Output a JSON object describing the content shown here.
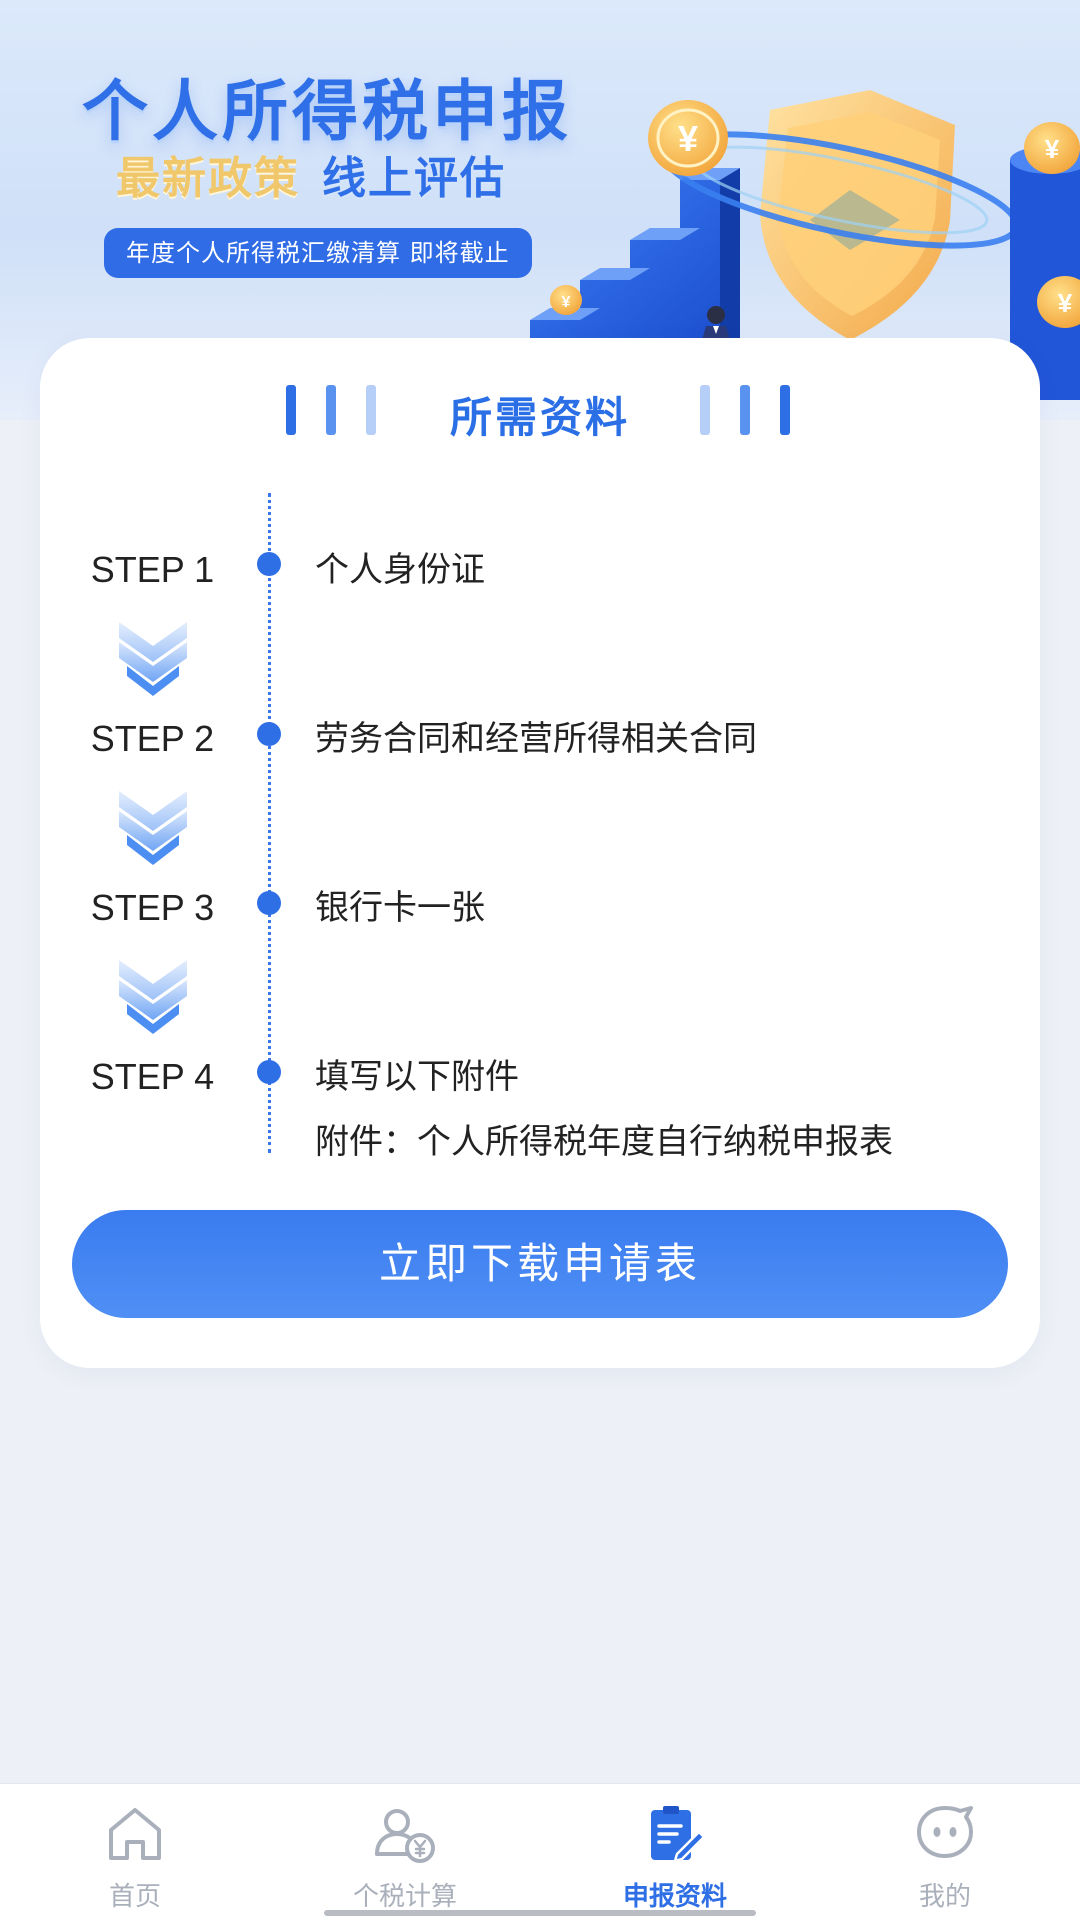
{
  "banner": {
    "title": "个人所得税申报",
    "subtitle_gold": "最新政策",
    "subtitle_blue": "线上评估",
    "pill": "年度个人所得税汇缴清算 即将截止",
    "coin_symbol": "¥"
  },
  "card": {
    "section_title": "所需资料",
    "steps": [
      {
        "label": "STEP 1",
        "text": "个人身份证"
      },
      {
        "label": "STEP 2",
        "text": "劳务合同和经营所得相关合同"
      },
      {
        "label": "STEP 3",
        "text": "银行卡一张"
      },
      {
        "label": "STEP 4",
        "text": "填写以下附件",
        "extra": "附件：个人所得税年度自行纳税申报表"
      }
    ],
    "download_button": "立即下载申请表"
  },
  "tabbar": {
    "items": [
      {
        "label": "首页",
        "icon": "home-icon",
        "active": false
      },
      {
        "label": "个税计算",
        "icon": "user-yen-icon",
        "active": false
      },
      {
        "label": "申报资料",
        "icon": "clipboard-edit-icon",
        "active": true
      },
      {
        "label": "我的",
        "icon": "chat-face-icon",
        "active": false
      }
    ]
  },
  "colors": {
    "accent": "#2f6fe6",
    "inactive": "#aab0bb",
    "page_bg": "#edf0f6",
    "gold": "#f0c76a"
  }
}
